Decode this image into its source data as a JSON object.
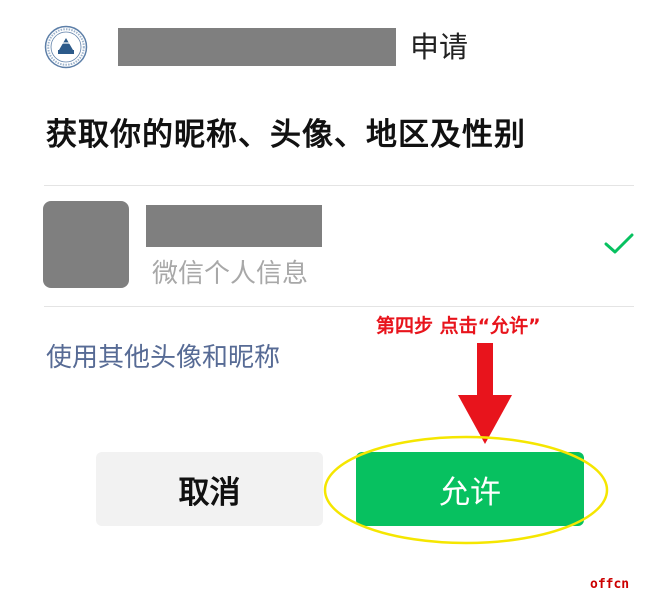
{
  "header": {
    "logo_icon": "school-seal-logo",
    "app_name": "",
    "apply_label": "申请"
  },
  "request": {
    "title": "获取你的昵称、头像、地区及性别"
  },
  "profile": {
    "nickname": "",
    "subtitle": "微信个人信息",
    "selected": true,
    "check_icon": "checkmark-icon",
    "check_color": "#07c160"
  },
  "other_option": {
    "label": "使用其他头像和昵称"
  },
  "annotation": {
    "step_text": "第四步 点击“允许”",
    "color": "#e8141c",
    "arrow_icon": "down-arrow-icon",
    "highlight_color": "#f5e600"
  },
  "actions": {
    "cancel_label": "取消",
    "allow_label": "允许",
    "allow_color": "#07c160"
  },
  "watermark": {
    "text": "offcn"
  }
}
